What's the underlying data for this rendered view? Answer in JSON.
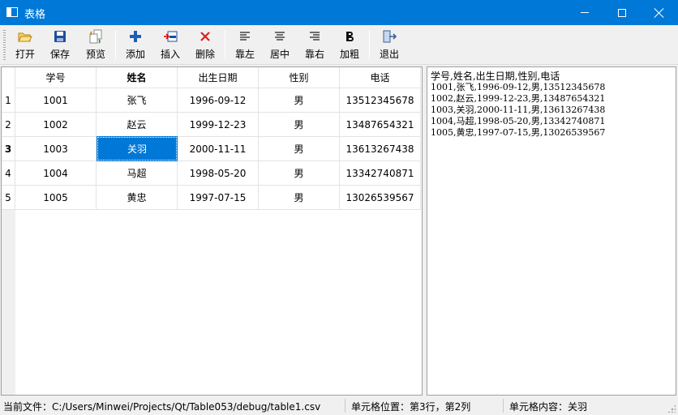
{
  "window": {
    "title": "表格"
  },
  "toolbar": {
    "open": "打开",
    "save": "保存",
    "preview": "预览",
    "add": "添加",
    "insert": "插入",
    "delete": "删除",
    "align_left": "靠左",
    "align_center": "居中",
    "align_right": "靠右",
    "bold": "加粗",
    "exit": "退出"
  },
  "table": {
    "headers": [
      "学号",
      "姓名",
      "出生日期",
      "性别",
      "电话"
    ],
    "row_numbers": [
      "1",
      "2",
      "3",
      "4",
      "5"
    ],
    "rows": [
      [
        "1001",
        "张飞",
        "1996-09-12",
        "男",
        "13512345678"
      ],
      [
        "1002",
        "赵云",
        "1999-12-23",
        "男",
        "13487654321"
      ],
      [
        "1003",
        "关羽",
        "2000-11-11",
        "男",
        "13613267438"
      ],
      [
        "1004",
        "马超",
        "1998-05-20",
        "男",
        "13342740871"
      ],
      [
        "1005",
        "黄忠",
        "1997-07-15",
        "男",
        "13026539567"
      ]
    ],
    "selected": {
      "row": 3,
      "column": 2
    }
  },
  "text_view": {
    "lines": [
      "学号,姓名,出生日期,性别,电话",
      "1001,张飞,1996-09-12,男,13512345678",
      "1002,赵云,1999-12-23,男,13487654321",
      "1003,关羽,2000-11-11,男,13613267438",
      "1004,马超,1998-05-20,男,13342740871",
      "1005,黄忠,1997-07-15,男,13026539567"
    ]
  },
  "status": {
    "file": "当前文件：C:/Users/Minwei/Projects/Qt/Table053/debug/table1.csv",
    "position": "单元格位置：第3行，第2列",
    "content": "单元格内容：关羽"
  },
  "colors": {
    "accent": "#0078d7",
    "window_bg": "#f0f0f0"
  }
}
